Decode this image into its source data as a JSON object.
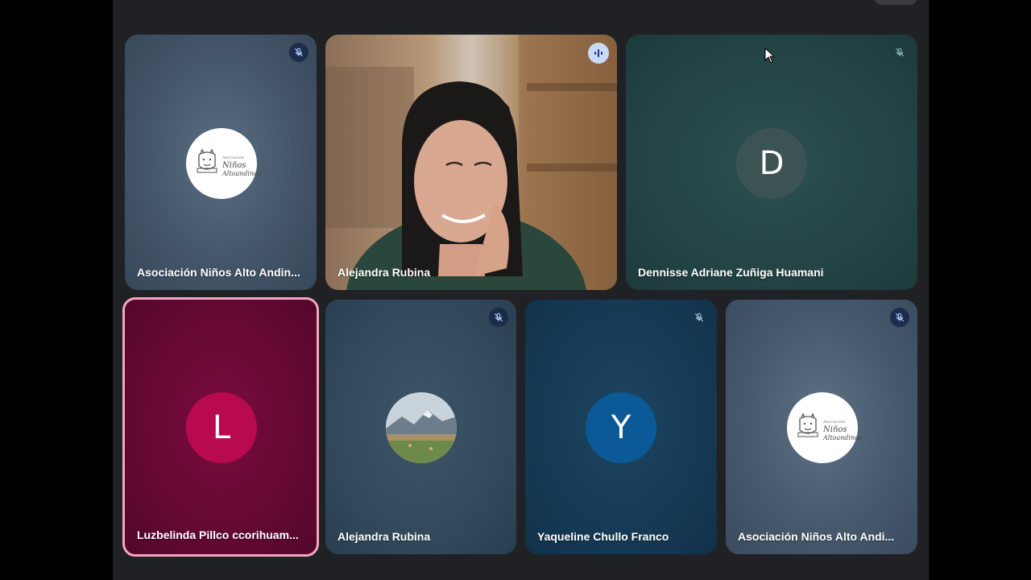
{
  "tiles": [
    {
      "name": "Asociación Niños Alto Andin...",
      "avatar": "logo",
      "logo_small": "Asociación",
      "logo_line1": "Niños",
      "logo_line2": "Altoandinos",
      "muted": true
    },
    {
      "name": "Alejandra Rubina",
      "avatar": "video",
      "speaking": true,
      "muted": false
    },
    {
      "name": "Dennisse Adriane Zuñiga Huamani",
      "avatar_letter": "D",
      "muted": true
    },
    {
      "name": "Luzbelinda Pillco ccorihuam...",
      "avatar_letter": "L",
      "muted": false,
      "active_speaker_border": true
    },
    {
      "name": "Alejandra Rubina",
      "avatar": "landscape-photo",
      "muted": true
    },
    {
      "name": "Yaqueline Chullo Franco",
      "avatar_letter": "Y",
      "muted": true
    },
    {
      "name": "Asociación Niños Alto Andi...",
      "avatar": "logo",
      "logo_small": "Asociación",
      "logo_line1": "Niños",
      "logo_line2": "Altoandinos",
      "muted": true
    }
  ],
  "colors": {
    "meet_background": "#202124",
    "active_border": "#f4a6c0",
    "avatar_d": "#3b5353",
    "avatar_l": "#b9094f",
    "avatar_y": "#0b5a97",
    "speaking_indicator": "#c9d9f6"
  },
  "icons": [
    "microphone-off-icon",
    "audio-wave-icon",
    "mouse-cursor-icon",
    "llama-icon"
  ]
}
